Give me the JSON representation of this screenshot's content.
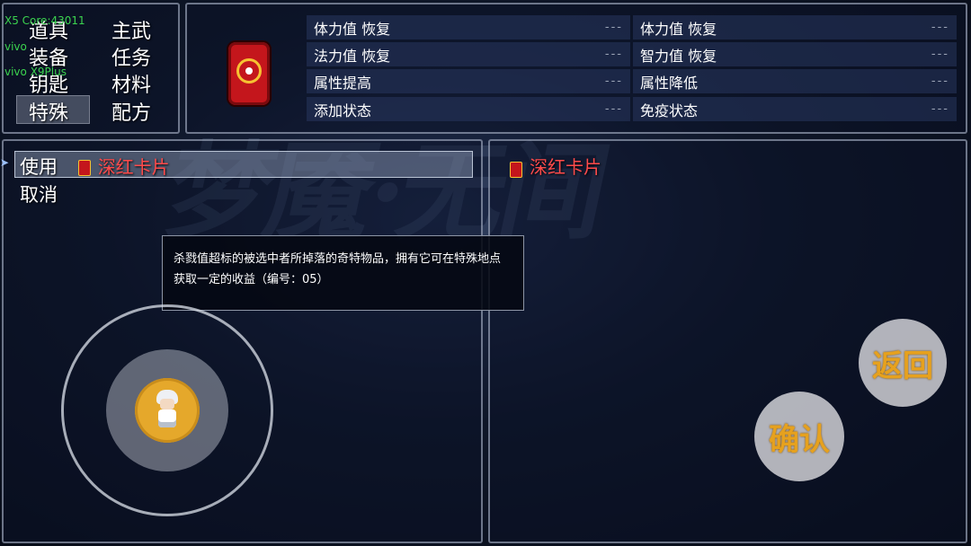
{
  "debug_overlay": [
    "X5 Core:43011",
    "vivo",
    "vivo X9Plus"
  ],
  "menu": {
    "categories": [
      "道具",
      "主武",
      "装备",
      "任务",
      "钥匙",
      "材料",
      "特殊",
      "配方"
    ],
    "selected": "特殊"
  },
  "detail": {
    "stats_left": [
      {
        "label": "体力值  恢复",
        "value": "---"
      },
      {
        "label": "法力值  恢复",
        "value": "---"
      },
      {
        "label": "属性提高",
        "value": "---"
      },
      {
        "label": "添加状态",
        "value": "---"
      }
    ],
    "stats_right": [
      {
        "label": "体力值  恢复",
        "value": "---"
      },
      {
        "label": "智力值  恢复",
        "value": "---"
      },
      {
        "label": "属性降低",
        "value": "---"
      },
      {
        "label": "免疫状态",
        "value": "---"
      }
    ]
  },
  "commands": {
    "use": "使用",
    "cancel": "取消",
    "item_name": "深红卡片"
  },
  "target": {
    "item_name": "深红卡片"
  },
  "help": {
    "line1": "杀戮值超标的被选中者所掉落的奇特物品，拥有它可在特殊地点",
    "line2": "获取一定的收益（编号：05）"
  },
  "buttons": {
    "back": "返回",
    "confirm": "确认"
  },
  "colors": {
    "item_name": "#ff4b4b",
    "button_text": "#e6a11e",
    "card_red": "#c4161c"
  },
  "background_title": "梦魇·无间"
}
